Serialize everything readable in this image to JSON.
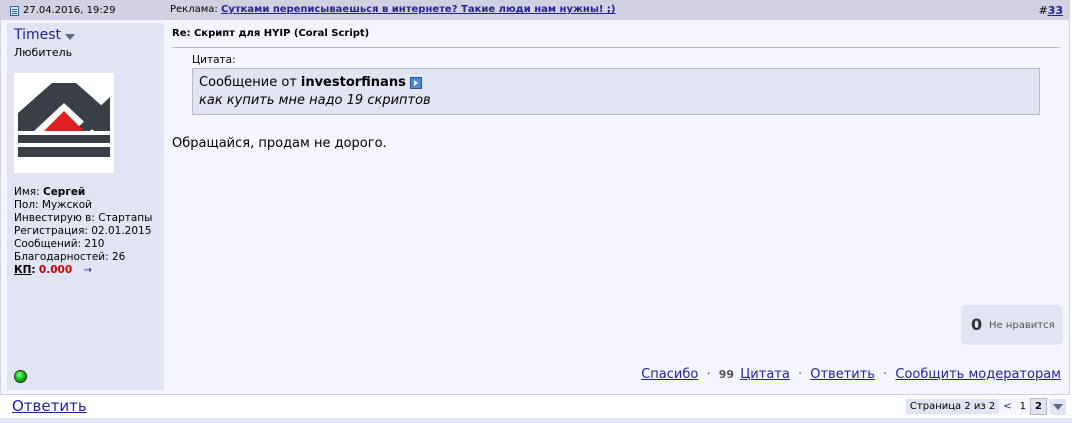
{
  "post": {
    "date": "27.04.2016, 19:29",
    "ad_label": "Реклама:",
    "ad_link": "Сутками переписываешься в интернете? Такие люди нам нужны! ;)",
    "post_number_prefix": "#",
    "post_number": "33"
  },
  "user": {
    "name": "Timest",
    "title": "Любитель",
    "details": {
      "name_label": "Имя:",
      "name_value": "Сергей",
      "gender": "Пол: Мужской",
      "invest": "Инвестирую в: Стартапы",
      "registration": "Регистрация: 02.01.2015",
      "messages": "Сообщений: 210",
      "thanks": "Благодарностей: 26",
      "kp_label": "КП",
      "kp_colon": ":",
      "kp_value": "0.000",
      "kp_arrow": "→"
    },
    "online_status_icon": "online-indicator-icon"
  },
  "content": {
    "title": "Re: Скрипт для HYIP (Coral Script)",
    "quote_label": "Цитата:",
    "quote_author_prefix": "Сообщение от",
    "quote_author": "investorfinans",
    "quote_text": "как купить мне надо 19 скриптов",
    "message": "Обращайся, продам не дорого."
  },
  "like": {
    "count": "0",
    "label": "Не нравится"
  },
  "actions": {
    "thanks": "Спасибо",
    "sep": "·",
    "quote_glyph": "99",
    "quote": "Цитата",
    "reply": "Ответить",
    "report": "Сообщить модераторам"
  },
  "footer": {
    "reply": "Ответить",
    "page_info": "Страница 2 из 2",
    "prev": "<",
    "page1": "1",
    "page2": "2"
  }
}
